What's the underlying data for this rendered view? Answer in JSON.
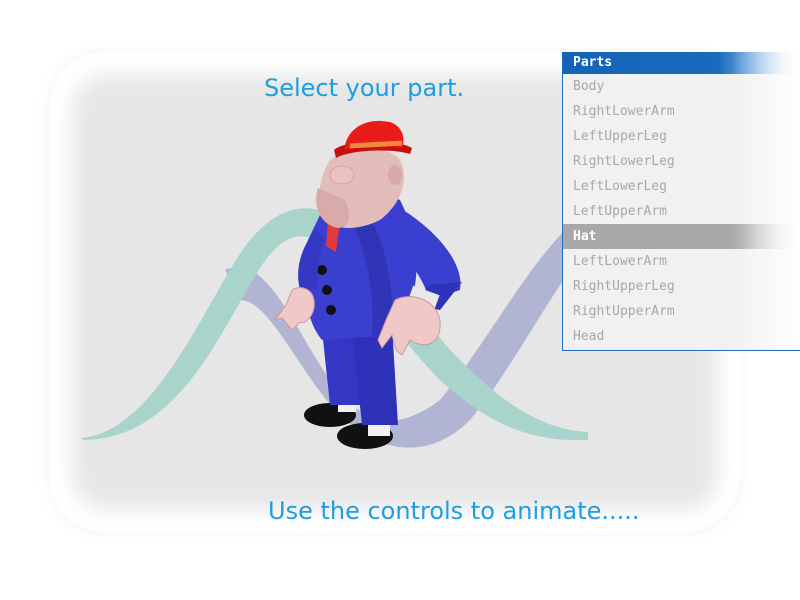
{
  "captions": {
    "top": "Select your part.",
    "bottom": "Use the controls to animate....."
  },
  "parts": {
    "header": "Parts",
    "selected": "Hat",
    "items": [
      "Body",
      "RightLowerArm",
      "LeftUpperLeg",
      "RightLowerLeg",
      "LeftLowerLeg",
      "LeftUpperArm",
      "Hat",
      "LeftLowerArm",
      "RightUpperLeg",
      "RightUpperArm",
      "Head"
    ]
  },
  "colors": {
    "accent": "#1e9ee0",
    "panel_header": "#1a6bbd",
    "selected_row": "#a9a9a9",
    "suit": "#3a3fd0",
    "hat": "#e81a1a",
    "logo_teal": "#a9d4cc",
    "logo_lavender": "#b1b5d3"
  },
  "scene": {
    "character": "3d-cartoon-man-in-blue-suit-and-red-hat",
    "background_logo": "double-wave-logo"
  }
}
